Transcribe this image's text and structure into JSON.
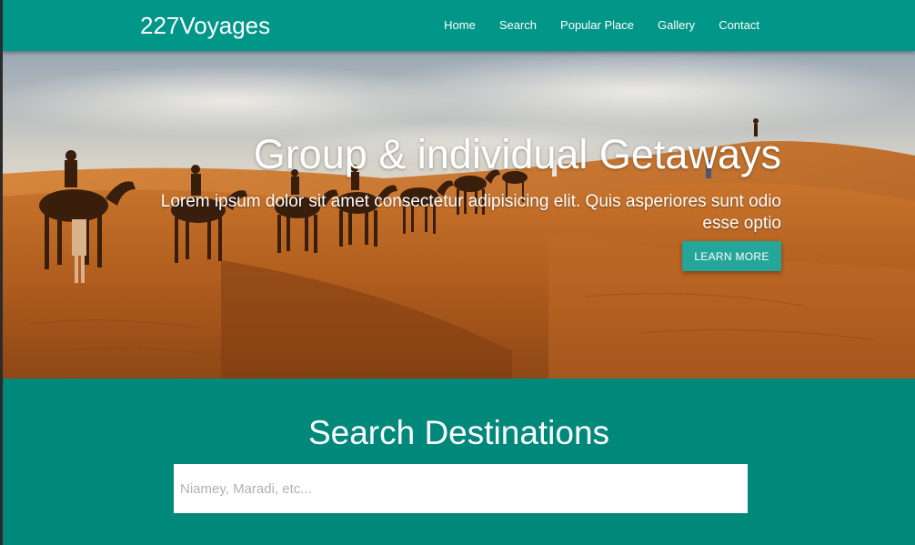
{
  "navbar": {
    "brand": "227Voyages",
    "links": [
      "Home",
      "Search",
      "Popular Place",
      "Gallery",
      "Contact"
    ]
  },
  "hero": {
    "title": "Group & individual Getaways",
    "subtitle": "Lorem ipsum dolor sit amet consectetur adipisicing elit. Quis asperiores sunt odio esse optio",
    "button_label": "LEARN MORE",
    "image_subject": "camel-caravan-desert-photo"
  },
  "search": {
    "title": "Search Destinations",
    "placeholder": "Niamey, Maradi, etc...",
    "value": ""
  },
  "colors": {
    "navbar": "#009688",
    "button": "#26a69a",
    "section": "#00897b",
    "text": "#ffffff"
  }
}
